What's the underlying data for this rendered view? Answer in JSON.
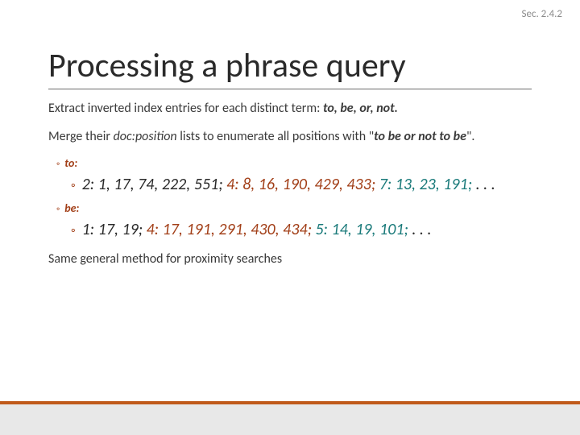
{
  "section_label": "Sec. 2.4.2",
  "title": "Processing a phrase query",
  "para1_lead": "Extract inverted index entries for each distinct term: ",
  "para1_terms": "to, be, or, not.",
  "para2_lead": "Merge their ",
  "para2_em": "doc:position",
  "para2_mid": " lists to enumerate all positions with \"",
  "para2_phrase": "to be or not to be",
  "para2_tail": "\".",
  "to_label": "to:",
  "to_seg1": "2: 1, 17, 74, 222, 551;",
  "to_seg2": "4: 8, 16, 190, 429, 433;",
  "to_seg3": "7: 13, 23, 191;",
  "to_ell": ". . .",
  "be_label": "be:",
  "be_seg1": "1: 17, 19;",
  "be_seg2": "4: 17, 191, 291, 430, 434;",
  "be_seg3": "5: 14, 19, 101;",
  "be_ell": ". . .",
  "closing": "Same general method for proximity searches"
}
